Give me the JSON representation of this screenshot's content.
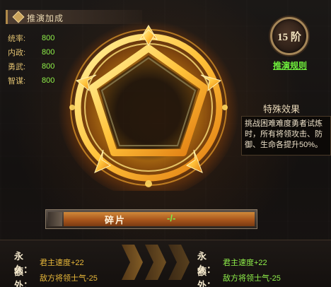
{
  "header": {
    "title": "推演加成"
  },
  "stats": [
    {
      "label": "统率:",
      "value": "800"
    },
    {
      "label": "内政:",
      "value": "800"
    },
    {
      "label": "勇武:",
      "value": "800"
    },
    {
      "label": "智谋:",
      "value": "800"
    }
  ],
  "rank": {
    "label": "15 阶"
  },
  "rules_link": "推演规则",
  "special": {
    "title": "特殊效果",
    "description": "挑战困难难度勇者试炼时，所有将领攻击、防御、生命各提升50%。"
  },
  "fragment_bar": {
    "label": "碎片",
    "value": "-/-"
  },
  "bottom": {
    "left": [
      {
        "key": "永久：",
        "value": "君主速度+22"
      },
      {
        "key": "额外：",
        "value": "敌方将领士气-25"
      }
    ],
    "right": [
      {
        "key": "永久：",
        "value": "君主速度+22"
      },
      {
        "key": "额外：",
        "value": "敌方将领士气-25"
      }
    ]
  },
  "colors": {
    "accent_gold": "#e8b83a",
    "value_green": "#8ff04a"
  }
}
